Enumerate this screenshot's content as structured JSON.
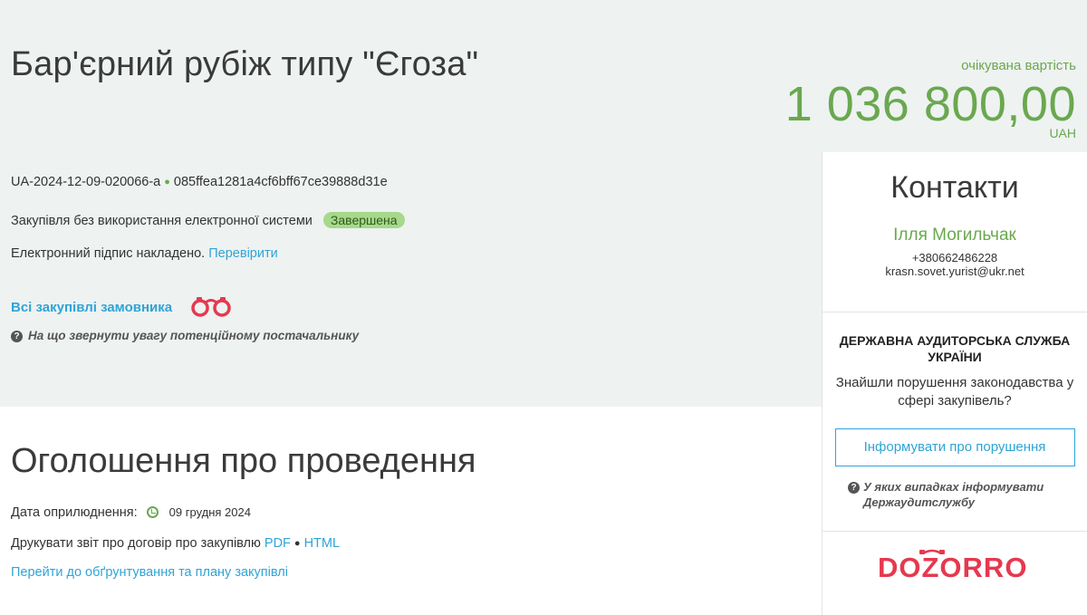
{
  "tender": {
    "title": "Бар'єрний рубіж типу \"Єгоза\"",
    "id": "UA-2024-12-09-020066-a",
    "hash": "085ffea1281a4cf6bff67ce39888d31e",
    "procedure": "Закупівля без використання електронної системи",
    "status": "Завершена",
    "signature_text": "Електронний підпис накладено.",
    "signature_link": "Перевірити",
    "all_purchases_link": "Всі закупівлі замовника",
    "hint": "На що звернути увагу потенційному постачальнику"
  },
  "price": {
    "label": "очікувана вартість",
    "value": "1 036 800,00",
    "currency": "UAH"
  },
  "announcement": {
    "title": "Оголошення про проведення",
    "date_label": "Дата оприлюднення:",
    "date_value": "09 грудня 2024",
    "print_label": "Друкувати звіт про договір про закупівлю",
    "pdf_link": "PDF",
    "html_link": "HTML",
    "plan_link": "Перейти до обґрунтування та плану закупівлі"
  },
  "sidebar": {
    "contacts_title": "Контакти",
    "name": "Ілля Могильчак",
    "phone": "+380662486228",
    "email": "krasn.sovet.yurist@ukr.net",
    "audit_title": "ДЕРЖАВНА АУДИТОРСЬКА СЛУЖБА УКРАЇНИ",
    "audit_text": "Знайшли порушення законодавства у сфері закупівель?",
    "report_button": "Інформувати про порушення",
    "audit_hint": "У яких випадках інформувати Держаудитслужбу",
    "dozorro_logo": "DOZORRO"
  },
  "colors": {
    "accent_green": "#6aa84f",
    "link_blue": "#2fa4d7",
    "band_bg": "#eef2f1",
    "dozorro_red": "#e5394f"
  }
}
